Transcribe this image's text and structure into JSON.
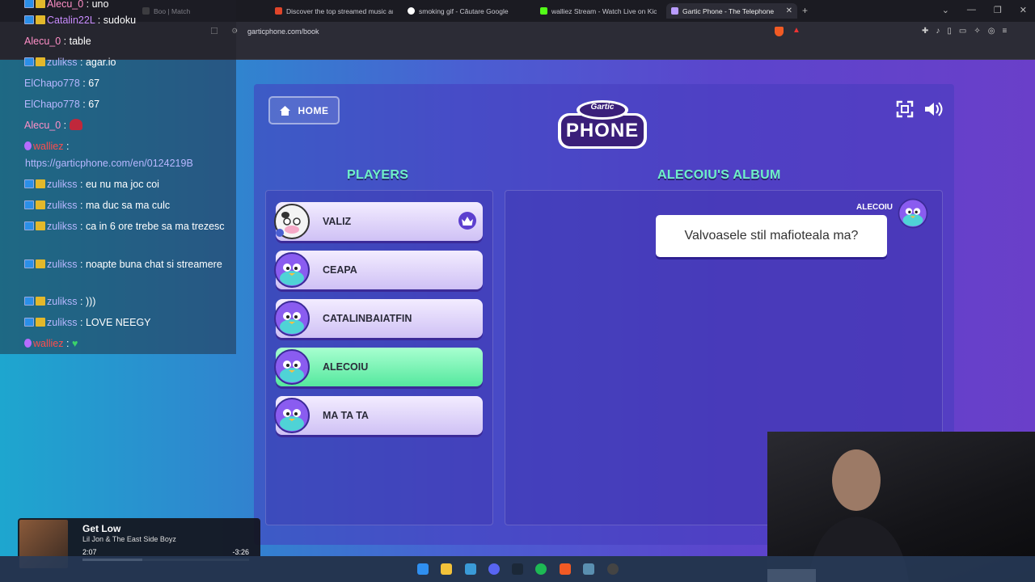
{
  "browser": {
    "tabs": [
      {
        "title": "Boo | Match",
        "color": "#555555"
      },
      {
        "title": "Discover the top streamed music an",
        "color": "#e0452a"
      },
      {
        "title": "smoking gif - Căutare Google",
        "color": "#ffffff"
      },
      {
        "title": "walliez Stream - Watch Live on Kick",
        "color": "#53fc18"
      },
      {
        "title": "Gartic Phone - The Telephone",
        "color": "#b99cff"
      }
    ],
    "url": "garticphone.com/book"
  },
  "game": {
    "home_label": "HOME",
    "logo_line1": "Gartic",
    "logo_line2": "PHONE",
    "players_title": "PLAYERS",
    "album_title": "ALECOIU'S ALBUM",
    "players": [
      {
        "name": "VALIZ",
        "host": true,
        "active": false
      },
      {
        "name": "CEAPA",
        "host": false,
        "active": false
      },
      {
        "name": "CATALINBAIATFIN",
        "host": false,
        "active": false
      },
      {
        "name": "ALECOIU",
        "host": false,
        "active": true
      },
      {
        "name": "MA TA TA",
        "host": false,
        "active": false
      }
    ],
    "album": {
      "author": "ALECOIU",
      "sentence": "Valvoasele stil mafioteala ma?"
    }
  },
  "chat": {
    "messages": [
      {
        "user": "Alecu_0",
        "text": "uno",
        "color": "#ff8fc7"
      },
      {
        "user": "Catalin22L",
        "text": "sudoku",
        "color": "#c98cff"
      },
      {
        "user": "Alecu_0",
        "text": "table",
        "color": "#ff8fc7"
      },
      {
        "user": "zulikss",
        "text": "agar.io",
        "color": "#b7b7ff"
      },
      {
        "user": "ElChapo778",
        "text": "67",
        "color": "#b7b7ff"
      },
      {
        "user": "ElChapo778",
        "text": "67",
        "color": "#b7b7ff"
      },
      {
        "user": "Alecu_0",
        "text": "",
        "color": "#ff8fc7"
      },
      {
        "user": "walliez",
        "text": "",
        "color": "#ff4d4d"
      },
      {
        "user": "",
        "text": "https://garticphone.com/en/0124219B",
        "color": "#b7b7ff"
      },
      {
        "user": "zulikss",
        "text": "eu nu ma joc coi",
        "color": "#b7b7ff"
      },
      {
        "user": "zulikss",
        "text": "ma duc sa ma culc",
        "color": "#b7b7ff"
      },
      {
        "user": "zulikss",
        "text": "ca in 6 ore trebe sa ma trezesc",
        "color": "#b7b7ff"
      },
      {
        "user": "zulikss",
        "text": "noapte buna chat si streamere",
        "color": "#b7b7ff"
      },
      {
        "user": "zulikss",
        "text": ")))",
        "color": "#b7b7ff"
      },
      {
        "user": "zulikss",
        "text": "LOVE NEEGY",
        "color": "#b7b7ff"
      },
      {
        "user": "walliez",
        "text": "",
        "color": "#ff4d4d"
      }
    ]
  },
  "music": {
    "title": "Get Low",
    "artist": "Lil Jon & The East Side Boyz",
    "elapsed": "2:07",
    "remaining": "-3:26",
    "progress": 0.36
  }
}
